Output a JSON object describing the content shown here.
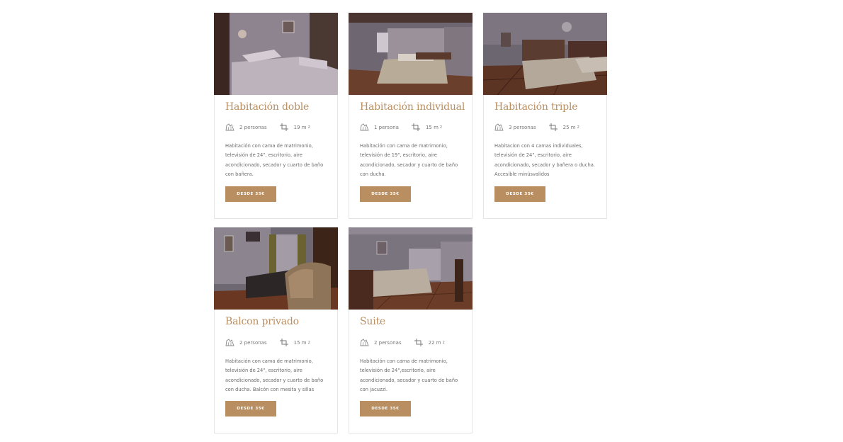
{
  "rooms": [
    {
      "title": "Habitación doble",
      "guests": "2 personas",
      "size": "19 m",
      "size_unit": "2",
      "description": "Habitación con cama de matrimonio, televisión de 24\", escritorio, aire acondicionado, secador y cuarto de baño con bañera.",
      "button": "DESDE 35€",
      "guests_icon": "guests-icon",
      "size_icon": "crop-area-icon"
    },
    {
      "title": "Habitación individual",
      "guests": "1 persona",
      "size": "15 m",
      "size_unit": "2",
      "description": "Habitación con cama de matrimonio, televisión de 19\", escritorio, aire acondicionado, secador y cuarto de baño con ducha.",
      "button": "DESDE 35€",
      "guests_icon": "guests-icon",
      "size_icon": "crop-area-icon"
    },
    {
      "title": "Habitación triple",
      "guests": "3 personas",
      "size": "25 m",
      "size_unit": "2",
      "description": "Habitacion con 4 camas individuales, televisión de 24\", escritorio, aire acondicionado, secador y bañera o ducha. Accesible minúsvalidos",
      "button": "DESDE 35€",
      "guests_icon": "guests-icon",
      "size_icon": "crop-area-icon"
    },
    {
      "title": "Balcon privado",
      "guests": "2 personas",
      "size": "15 m",
      "size_unit": "2",
      "description": "Habitación con cama de matrimonio, televisión de 24\", escritorio, aire acondicionado, secador y cuarto de baño con ducha. Balcón con mesita y sillas",
      "button": "DESDE 35€",
      "guests_icon": "guests-icon",
      "size_icon": "crop-area-icon"
    },
    {
      "title": "Suite",
      "guests": "2 personas",
      "size": "22 m",
      "size_unit": "2",
      "description": "Habitación con cama de matrimonio, televisión de 24\",escritorio, aire acondicionado, secador y cuarto de baño con jacuzzi.",
      "button": "DESDE 35€",
      "guests_icon": "guests-icon",
      "size_icon": "crop-area-icon"
    }
  ],
  "colors": {
    "accent": "#b98f62",
    "border": "#e6e6e6",
    "text": "#6b6b6b"
  }
}
